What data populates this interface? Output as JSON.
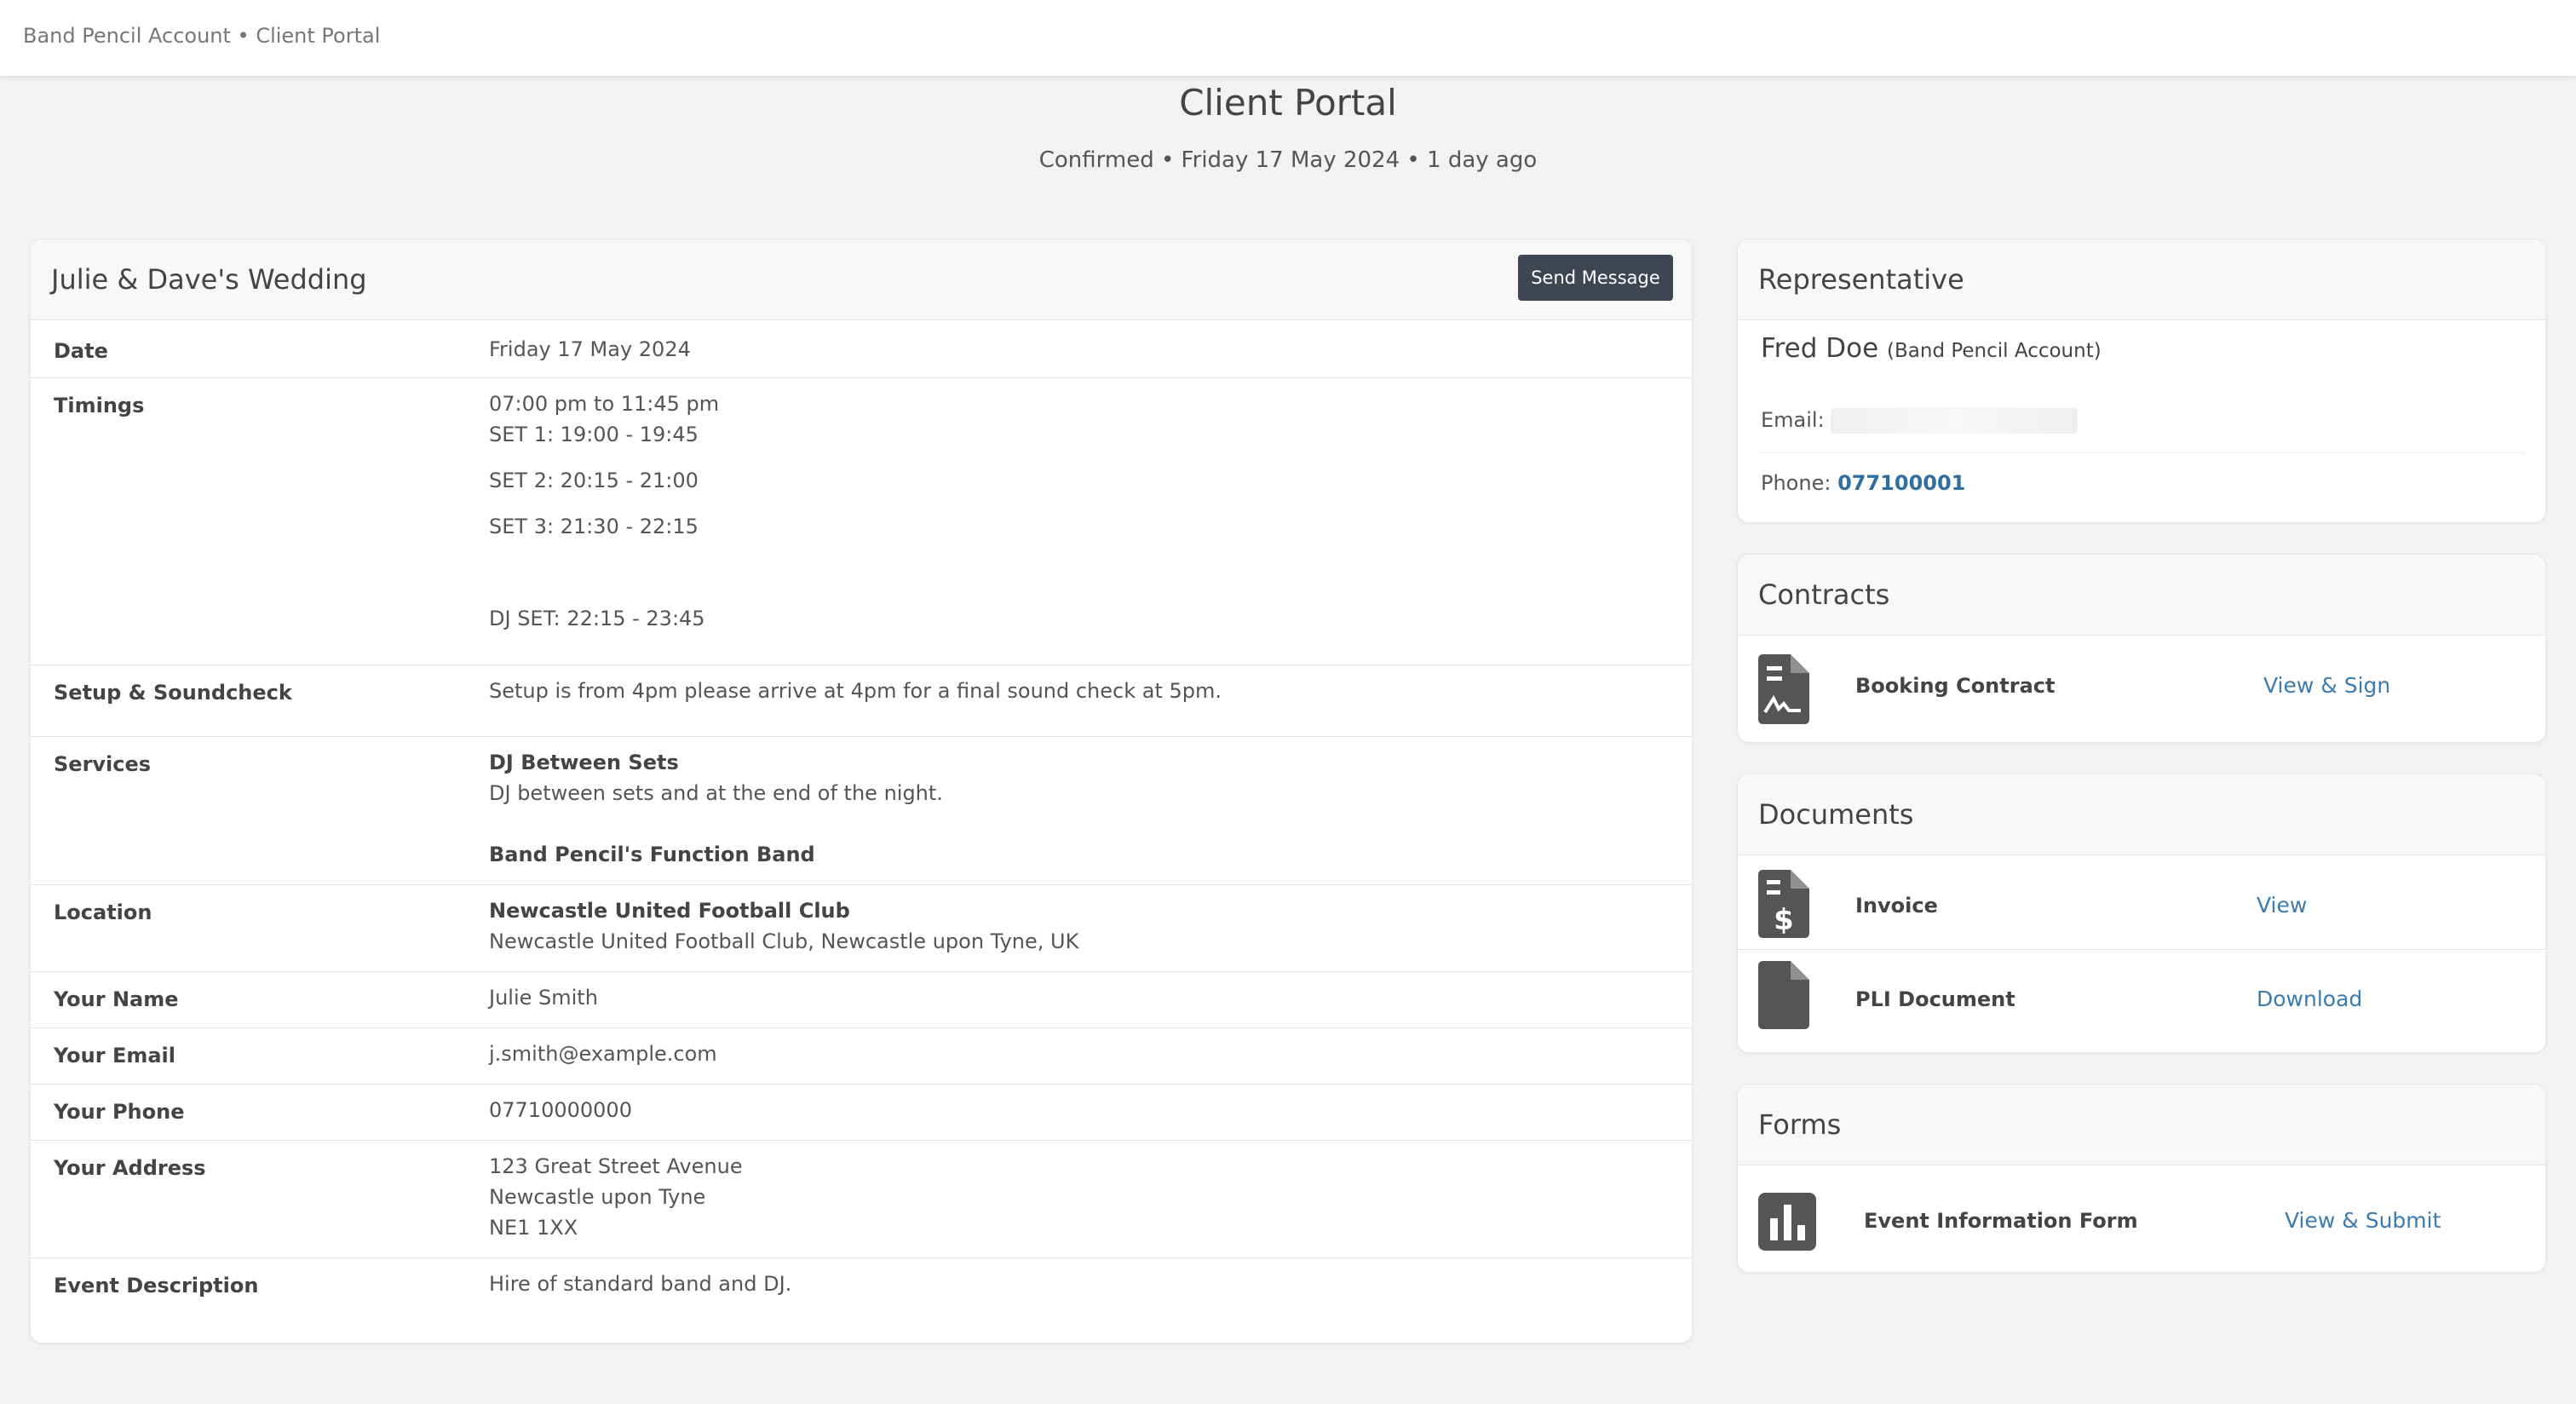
{
  "topbar": {
    "breadcrumb": "Band Pencil Account • Client Portal"
  },
  "page": {
    "title": "Client Portal",
    "subtitle": "Confirmed • Friday 17 May 2024 • 1 day ago"
  },
  "event": {
    "title": "Julie & Dave's Wedding",
    "send_message_label": "Send Message",
    "rows": {
      "date": {
        "label": "Date",
        "value": "Friday 17 May 2024"
      },
      "timings": {
        "label": "Timings",
        "line1": "07:00 pm to 11:45 pm",
        "line2": "SET 1: 19:00 - 19:45",
        "line3": "SET 2: 20:15 - 21:00",
        "line4": "SET 3: 21:30 - 22:15",
        "line5": "DJ SET: 22:15 - 23:45"
      },
      "setup": {
        "label": "Setup & Soundcheck",
        "value": "Setup is from 4pm please arrive at 4pm for a final sound check at 5pm."
      },
      "services": {
        "label": "Services",
        "service1_name": "DJ Between Sets",
        "service1_desc": "DJ between sets and at the end of the night.",
        "service2_name": "Band Pencil's Function Band"
      },
      "location": {
        "label": "Location",
        "name": "Newcastle United Football Club",
        "address": "Newcastle United Football Club, Newcastle upon Tyne, UK"
      },
      "name": {
        "label": "Your Name",
        "value": "Julie Smith"
      },
      "email": {
        "label": "Your Email",
        "value": "j.smith@example.com"
      },
      "phone": {
        "label": "Your Phone",
        "value": "07710000000"
      },
      "address": {
        "label": "Your Address",
        "line1": "123 Great Street Avenue",
        "line2": "Newcastle upon Tyne",
        "line3": "NE1 1XX"
      },
      "description": {
        "label": "Event Description",
        "value": "Hire of standard band and DJ."
      }
    }
  },
  "representative": {
    "title": "Representative",
    "name": "Fred Doe",
    "org": "(Band Pencil Account)",
    "email_label": "Email:",
    "phone_label": "Phone:",
    "phone": "077100001"
  },
  "contracts": {
    "title": "Contracts",
    "items": [
      {
        "name": "Booking Contract",
        "action": "View & Sign",
        "icon": "contract-signature-icon"
      }
    ]
  },
  "documents": {
    "title": "Documents",
    "items": [
      {
        "name": "Invoice",
        "action": "View",
        "icon": "invoice-dollar-icon"
      },
      {
        "name": "PLI Document",
        "action": "Download",
        "icon": "file-icon"
      }
    ]
  },
  "forms": {
    "title": "Forms",
    "items": [
      {
        "name": "Event Information Form",
        "action": "View & Submit",
        "icon": "bar-chart-icon"
      }
    ]
  },
  "colors": {
    "link": "#3b7bb0",
    "button": "#3f4651",
    "icon": "#555555"
  }
}
